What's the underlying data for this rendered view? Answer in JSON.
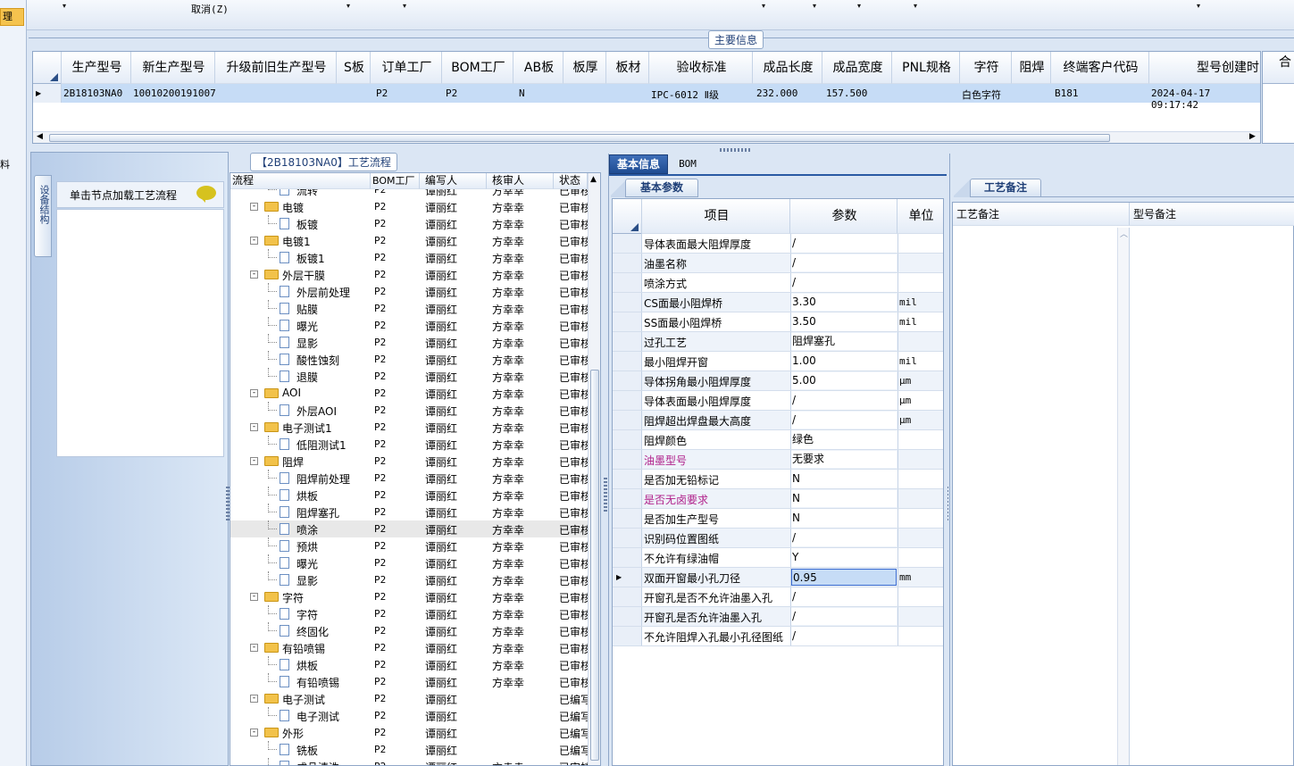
{
  "top_bar": {
    "cancel_label": "取消(Z)",
    "left_partial_label": "理"
  },
  "main_info": {
    "legend": "主要信息",
    "columns": [
      "生产型号",
      "新生产型号",
      "升级前旧生产型号",
      "S板",
      "订单工厂",
      "BOM工厂",
      "AB板",
      "板厚",
      "板材",
      "验收标准",
      "成品长度",
      "成品宽度",
      "PNL规格",
      "字符",
      "阻焊",
      "终端客户代码",
      "型号创建时",
      "合"
    ],
    "row": [
      "2B18103NA0",
      "10010200191007",
      "",
      "",
      "P2",
      "P2",
      "N",
      "",
      "",
      "IPC-6012 Ⅱ级",
      "232.000",
      "157.500",
      "",
      "白色字符",
      "",
      "B181",
      "2024-04-17 09:17:42",
      ""
    ]
  },
  "side_panel": {
    "vertical_tab": "设备结构",
    "load_hint": "单击节点加载工艺流程",
    "left_edge_char": "料"
  },
  "process_flow": {
    "legend": "【2B18103NA0】工艺流程",
    "columns": [
      "流程",
      "BOM工厂",
      "编写人",
      "核审人",
      "状态"
    ],
    "rows": [
      {
        "level": 1,
        "type": "file",
        "name": "流转",
        "factory": "P2",
        "writer": "谭丽红",
        "reviewer": "方幸幸",
        "status": "已审核"
      },
      {
        "level": 0,
        "type": "folder",
        "name": "电镀",
        "factory": "P2",
        "writer": "谭丽红",
        "reviewer": "方幸幸",
        "status": "已审核"
      },
      {
        "level": 1,
        "type": "file",
        "name": "板镀",
        "factory": "P2",
        "writer": "谭丽红",
        "reviewer": "方幸幸",
        "status": "已审核"
      },
      {
        "level": 0,
        "type": "folder",
        "name": "电镀1",
        "factory": "P2",
        "writer": "谭丽红",
        "reviewer": "方幸幸",
        "status": "已审核"
      },
      {
        "level": 1,
        "type": "file",
        "name": "板镀1",
        "factory": "P2",
        "writer": "谭丽红",
        "reviewer": "方幸幸",
        "status": "已审核"
      },
      {
        "level": 0,
        "type": "folder",
        "name": "外层干膜",
        "factory": "P2",
        "writer": "谭丽红",
        "reviewer": "方幸幸",
        "status": "已审核"
      },
      {
        "level": 1,
        "type": "file",
        "name": "外层前处理",
        "factory": "P2",
        "writer": "谭丽红",
        "reviewer": "方幸幸",
        "status": "已审核"
      },
      {
        "level": 1,
        "type": "file",
        "name": "贴膜",
        "factory": "P2",
        "writer": "谭丽红",
        "reviewer": "方幸幸",
        "status": "已审核"
      },
      {
        "level": 1,
        "type": "file",
        "name": "曝光",
        "factory": "P2",
        "writer": "谭丽红",
        "reviewer": "方幸幸",
        "status": "已审核"
      },
      {
        "level": 1,
        "type": "file",
        "name": "显影",
        "factory": "P2",
        "writer": "谭丽红",
        "reviewer": "方幸幸",
        "status": "已审核"
      },
      {
        "level": 1,
        "type": "file",
        "name": "酸性蚀刻",
        "factory": "P2",
        "writer": "谭丽红",
        "reviewer": "方幸幸",
        "status": "已审核"
      },
      {
        "level": 1,
        "type": "file",
        "name": "退膜",
        "factory": "P2",
        "writer": "谭丽红",
        "reviewer": "方幸幸",
        "status": "已审核"
      },
      {
        "level": 0,
        "type": "folder",
        "name": "AOI",
        "factory": "P2",
        "writer": "谭丽红",
        "reviewer": "方幸幸",
        "status": "已审核"
      },
      {
        "level": 1,
        "type": "file",
        "name": "外层AOI",
        "factory": "P2",
        "writer": "谭丽红",
        "reviewer": "方幸幸",
        "status": "已审核"
      },
      {
        "level": 0,
        "type": "folder",
        "name": "电子测试1",
        "factory": "P2",
        "writer": "谭丽红",
        "reviewer": "方幸幸",
        "status": "已审核"
      },
      {
        "level": 1,
        "type": "file",
        "name": "低阻测试1",
        "factory": "P2",
        "writer": "谭丽红",
        "reviewer": "方幸幸",
        "status": "已审核"
      },
      {
        "level": 0,
        "type": "folder",
        "name": "阻焊",
        "factory": "P2",
        "writer": "谭丽红",
        "reviewer": "方幸幸",
        "status": "已审核"
      },
      {
        "level": 1,
        "type": "file",
        "name": "阻焊前处理",
        "factory": "P2",
        "writer": "谭丽红",
        "reviewer": "方幸幸",
        "status": "已审核"
      },
      {
        "level": 1,
        "type": "file",
        "name": "烘板",
        "factory": "P2",
        "writer": "谭丽红",
        "reviewer": "方幸幸",
        "status": "已审核"
      },
      {
        "level": 1,
        "type": "file",
        "name": "阻焊塞孔",
        "factory": "P2",
        "writer": "谭丽红",
        "reviewer": "方幸幸",
        "status": "已审核"
      },
      {
        "level": 1,
        "type": "file",
        "name": "喷涂",
        "factory": "P2",
        "writer": "谭丽红",
        "reviewer": "方幸幸",
        "status": "已审核",
        "selected": true
      },
      {
        "level": 1,
        "type": "file",
        "name": "预烘",
        "factory": "P2",
        "writer": "谭丽红",
        "reviewer": "方幸幸",
        "status": "已审核"
      },
      {
        "level": 1,
        "type": "file",
        "name": "曝光",
        "factory": "P2",
        "writer": "谭丽红",
        "reviewer": "方幸幸",
        "status": "已审核"
      },
      {
        "level": 1,
        "type": "file",
        "name": "显影",
        "factory": "P2",
        "writer": "谭丽红",
        "reviewer": "方幸幸",
        "status": "已审核"
      },
      {
        "level": 0,
        "type": "folder",
        "name": "字符",
        "factory": "P2",
        "writer": "谭丽红",
        "reviewer": "方幸幸",
        "status": "已审核"
      },
      {
        "level": 1,
        "type": "file",
        "name": "字符",
        "factory": "P2",
        "writer": "谭丽红",
        "reviewer": "方幸幸",
        "status": "已审核"
      },
      {
        "level": 1,
        "type": "file",
        "name": "终固化",
        "factory": "P2",
        "writer": "谭丽红",
        "reviewer": "方幸幸",
        "status": "已审核"
      },
      {
        "level": 0,
        "type": "folder",
        "name": "有铅喷锡",
        "factory": "P2",
        "writer": "谭丽红",
        "reviewer": "方幸幸",
        "status": "已审核"
      },
      {
        "level": 1,
        "type": "file",
        "name": "烘板",
        "factory": "P2",
        "writer": "谭丽红",
        "reviewer": "方幸幸",
        "status": "已审核"
      },
      {
        "level": 1,
        "type": "file",
        "name": "有铅喷锡",
        "factory": "P2",
        "writer": "谭丽红",
        "reviewer": "方幸幸",
        "status": "已审核"
      },
      {
        "level": 0,
        "type": "folder",
        "name": "电子测试",
        "factory": "P2",
        "writer": "谭丽红",
        "reviewer": "",
        "status": "已编写"
      },
      {
        "level": 1,
        "type": "file",
        "name": "电子测试",
        "factory": "P2",
        "writer": "谭丽红",
        "reviewer": "",
        "status": "已编写"
      },
      {
        "level": 0,
        "type": "folder",
        "name": "外形",
        "factory": "P2",
        "writer": "谭丽红",
        "reviewer": "",
        "status": "已编写"
      },
      {
        "level": 1,
        "type": "file",
        "name": "铣板",
        "factory": "P2",
        "writer": "谭丽红",
        "reviewer": "",
        "status": "已编写"
      },
      {
        "level": 1,
        "type": "file",
        "name": "成品清洗",
        "factory": "P2",
        "writer": "谭丽红",
        "reviewer": "方幸幸",
        "status": "已审核"
      }
    ]
  },
  "detail": {
    "tabs": [
      "基本信息",
      "BOM"
    ],
    "sub_tab": "基本参数",
    "columns": [
      "项目",
      "参数",
      "单位"
    ],
    "rows": [
      {
        "item": "导体表面最大阻焊厚度",
        "value": "/",
        "unit": ""
      },
      {
        "item": "油墨名称",
        "value": "/",
        "unit": ""
      },
      {
        "item": "喷涂方式",
        "value": "/",
        "unit": ""
      },
      {
        "item": "CS面最小阻焊桥",
        "value": "3.30",
        "unit": "mil"
      },
      {
        "item": "SS面最小阻焊桥",
        "value": "3.50",
        "unit": "mil"
      },
      {
        "item": "过孔工艺",
        "value": "阻焊塞孔",
        "unit": ""
      },
      {
        "item": "最小阻焊开窗",
        "value": "1.00",
        "unit": "mil"
      },
      {
        "item": "导体拐角最小阻焊厚度",
        "value": "5.00",
        "unit": "μm"
      },
      {
        "item": "导体表面最小阻焊厚度",
        "value": "/",
        "unit": "μm"
      },
      {
        "item": "阻焊超出焊盘最大高度",
        "value": "/",
        "unit": "μm"
      },
      {
        "item": "阻焊颜色",
        "value": "绿色",
        "unit": ""
      },
      {
        "item": "油墨型号",
        "value": "无要求",
        "unit": "",
        "highlight": true
      },
      {
        "item": "是否加无铅标记",
        "value": "N",
        "unit": ""
      },
      {
        "item": "是否无卤要求",
        "value": "N",
        "unit": "",
        "highlight": true
      },
      {
        "item": "是否加生产型号",
        "value": "N",
        "unit": ""
      },
      {
        "item": "识别码位置图纸",
        "value": "/",
        "unit": ""
      },
      {
        "item": "不允许有绿油帽",
        "value": "Y",
        "unit": ""
      },
      {
        "item": "双面开窗最小孔刀径",
        "value": "0.95",
        "unit": "mm",
        "current": true
      },
      {
        "item": "开窗孔是否不允许油墨入孔",
        "value": "/",
        "unit": ""
      },
      {
        "item": "开窗孔是否允许油墨入孔",
        "value": "/",
        "unit": ""
      },
      {
        "item": "不允许阻焊入孔最小孔径图纸",
        "value": "/",
        "unit": ""
      }
    ]
  },
  "remarks": {
    "tab": "工艺备注",
    "columns": [
      "工艺备注",
      "型号备注"
    ]
  },
  "colors": {
    "highlight_text": "#b0208a",
    "selection_row": "#c6dcf6",
    "panel_bg": "#dbe6f4"
  }
}
